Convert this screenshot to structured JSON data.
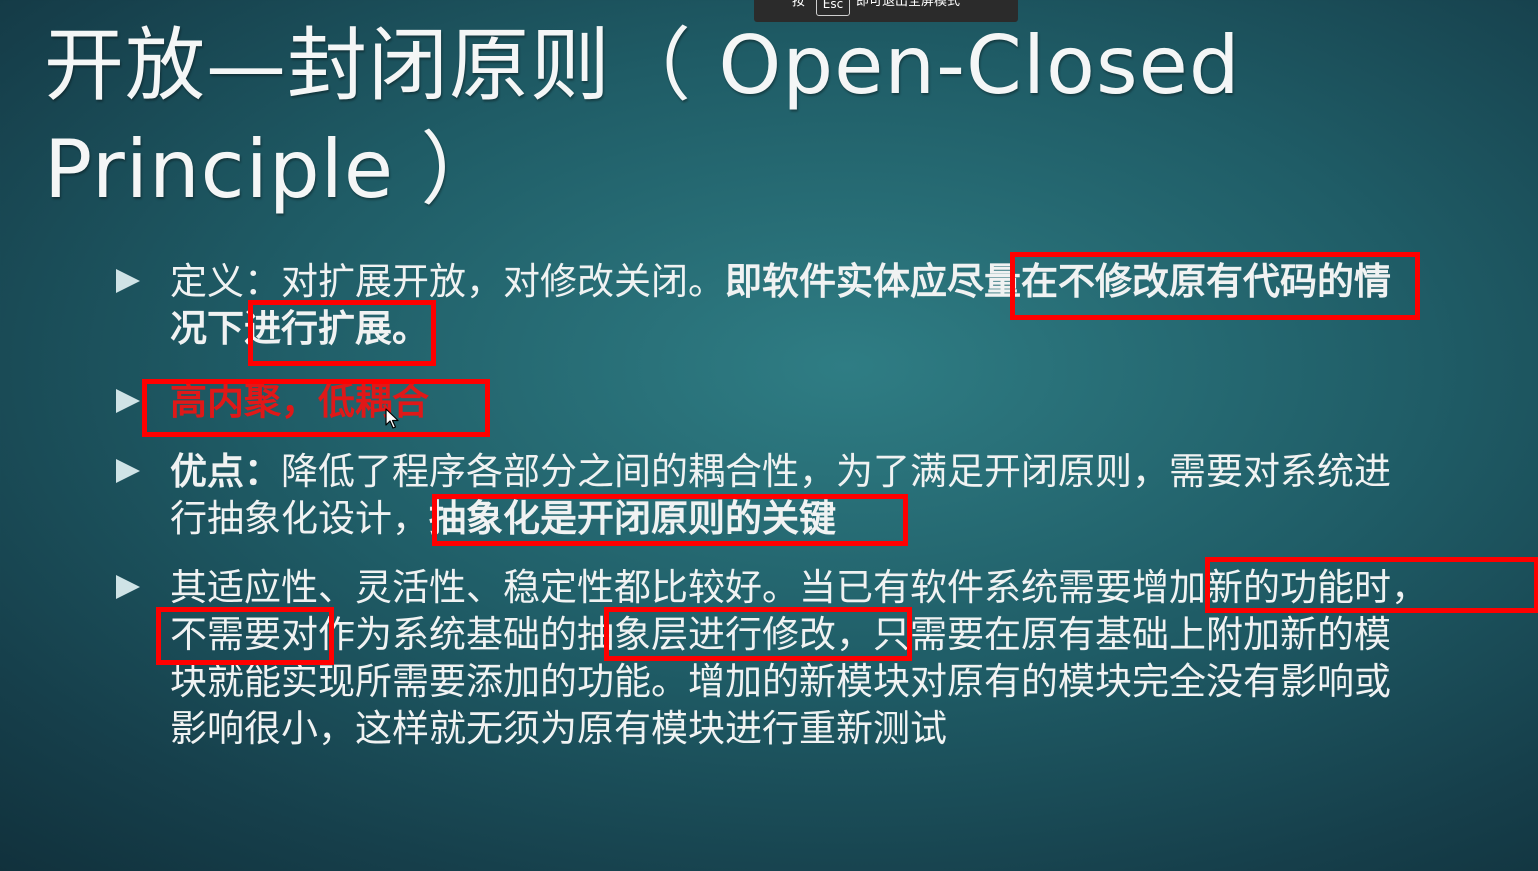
{
  "overlay": {
    "press_text": "按",
    "key_label": "Esc",
    "exit_text": "即可退出全屏模式"
  },
  "slide": {
    "title_line1": "开放—封闭原则（ Open-Closed",
    "title_line2": "Principle ）",
    "bullets": [
      {
        "line1_a": "定义：对扩展开放，对修改关闭。",
        "line1_b": "即软件实体应尽量在不修改原有代码的情",
        "line2_b": "况下进行扩展。"
      },
      {
        "text": "高内聚，低耦合"
      },
      {
        "line1_a": "优点：",
        "line1_b": "降低了程序各部分之间的耦合性，为了满足开闭原则，需要对系统进",
        "line2_a": "行抽象化设计，",
        "line2_b": "抽象化是开闭原则的关键"
      },
      {
        "line1": "其适应性、灵活性、稳定性都比较好。当已有软件系统需要增加新的功能时，",
        "line2": "不需要对作为系统基础的抽象层进行修改，只需要在原有基础上附加新的模",
        "line3": "块就能实现所需要添加的功能。增加的新模块对原有的模块完全没有影响或",
        "line4": "影响很小，这样就无须为原有模块进行重新测试"
      }
    ]
  },
  "colors": {
    "highlight_box": "#ff0000",
    "emphasis_text": "#e01818",
    "background": "#1f5c66"
  }
}
